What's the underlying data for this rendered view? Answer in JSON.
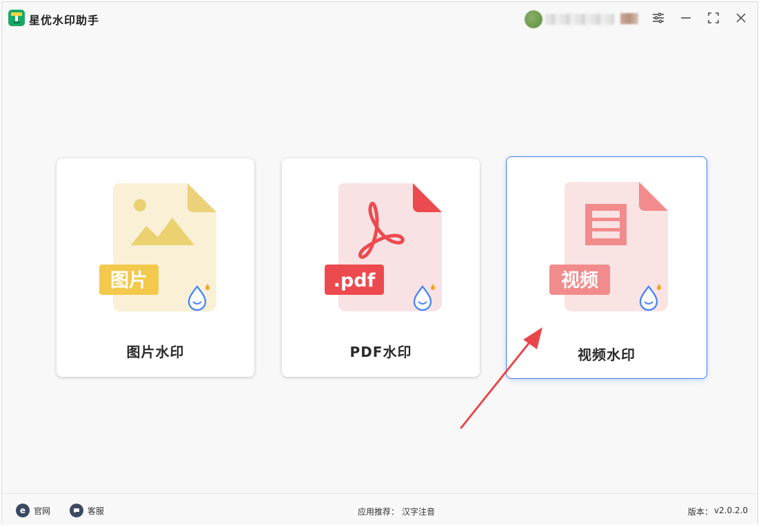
{
  "app": {
    "title": "星优水印助手",
    "colors": {
      "brand": "#1aa86a",
      "accent": "#3d7cf0",
      "arrow": "#e8474a"
    }
  },
  "titlebar": {
    "settings_icon": "sliders-icon",
    "minimize_icon": "minimize-icon",
    "maximize_icon": "maximize-icon",
    "close_icon": "close-icon"
  },
  "cards": [
    {
      "label": "图片水印",
      "badge": "图片",
      "icon": "image-file-icon",
      "color": "#f0c94b",
      "selected": false
    },
    {
      "label": "PDF水印",
      "badge": ".pdf",
      "icon": "pdf-file-icon",
      "color": "#ec4a4f",
      "selected": false
    },
    {
      "label": "视频水印",
      "badge": "视频",
      "icon": "video-file-icon",
      "color": "#f08688",
      "selected": true
    }
  ],
  "footer": {
    "website_label": "官网",
    "support_label": "客服",
    "recommend_prefix": "应用推荐：",
    "recommend_app": "汉字注音",
    "version_prefix": "版本：",
    "version": "v2.0.2.0"
  }
}
